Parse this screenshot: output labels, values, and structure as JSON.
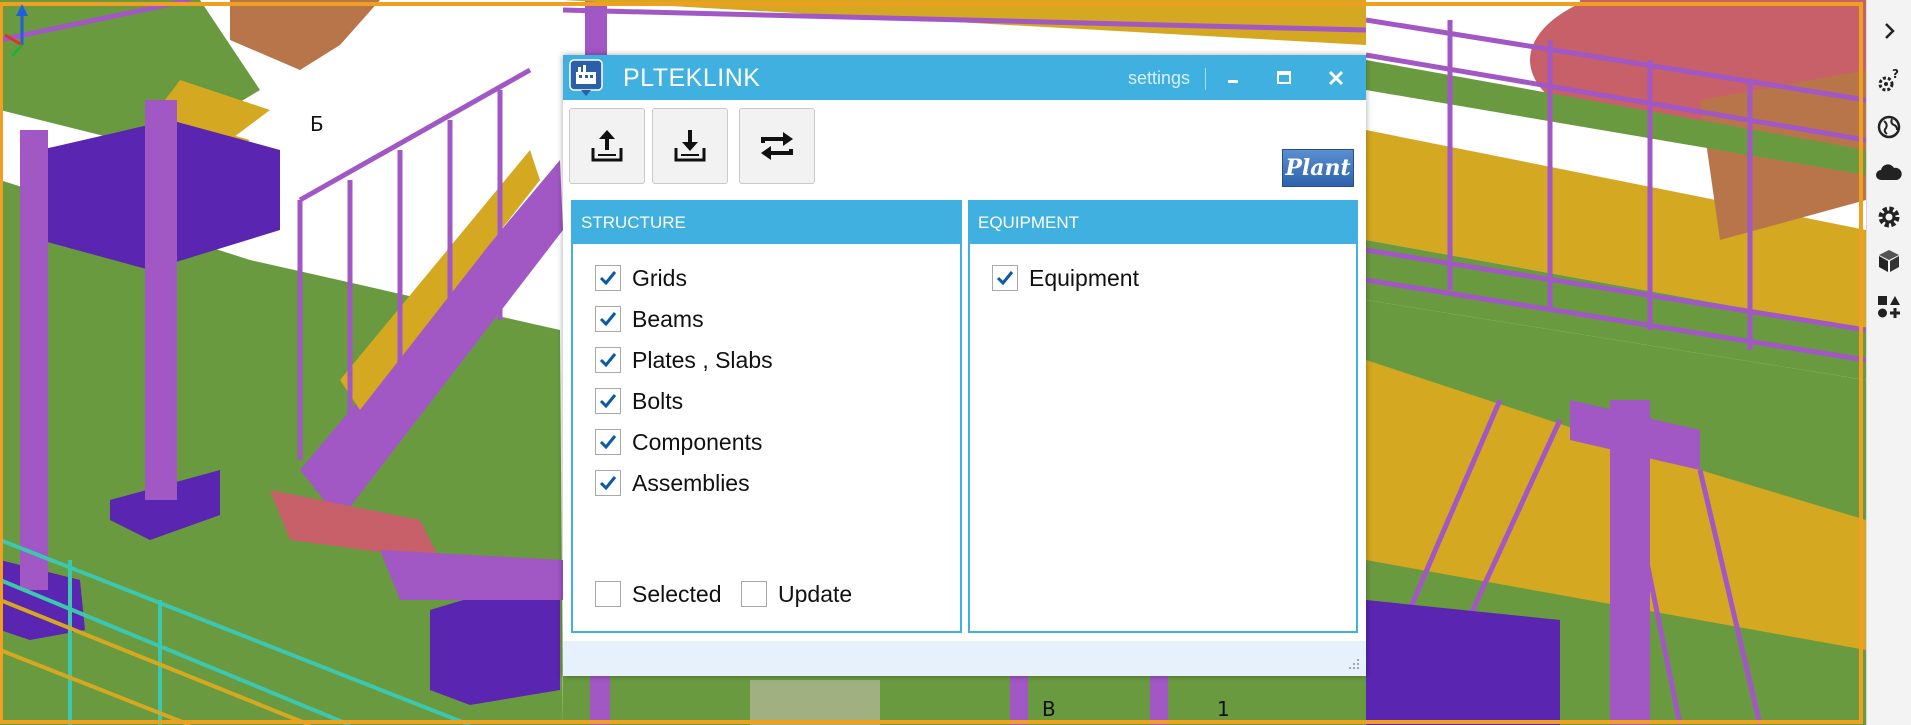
{
  "viewport": {
    "labels": [
      "Б",
      "B",
      "1"
    ]
  },
  "side_toolbar": {
    "icons": [
      "chevron-right-icon",
      "help-settings-icon",
      "globe-icon",
      "cloud-icon",
      "gear-icon",
      "cube-icon",
      "shapes-icon"
    ]
  },
  "dialog": {
    "title": "PLTEKLINK",
    "settings_label": "settings",
    "logo_text": "Plant",
    "toolbar": {
      "buttons": [
        "export-icon",
        "import-icon",
        "sync-icon"
      ]
    },
    "structure": {
      "header": "STRUCTURE",
      "items": [
        {
          "label": "Grids",
          "checked": true
        },
        {
          "label": "Beams",
          "checked": true
        },
        {
          "label": "Plates , Slabs",
          "checked": true
        },
        {
          "label": "Bolts",
          "checked": true
        },
        {
          "label": "Components",
          "checked": true
        },
        {
          "label": "Assemblies",
          "checked": true
        }
      ],
      "options": [
        {
          "label": "Selected",
          "checked": false
        },
        {
          "label": "Update",
          "checked": false
        }
      ]
    },
    "equipment": {
      "header": "EQUIPMENT",
      "items": [
        {
          "label": "Equipment",
          "checked": true
        }
      ]
    }
  },
  "colors": {
    "accent": "#3fb0e0",
    "steel_purple": "#a157c4",
    "floor_green": "#6a9a40",
    "grating_yellow": "#d4a820",
    "base_indigo": "#5a25b0",
    "tank_red": "#c76068",
    "frame_orange": "#f0a020"
  }
}
